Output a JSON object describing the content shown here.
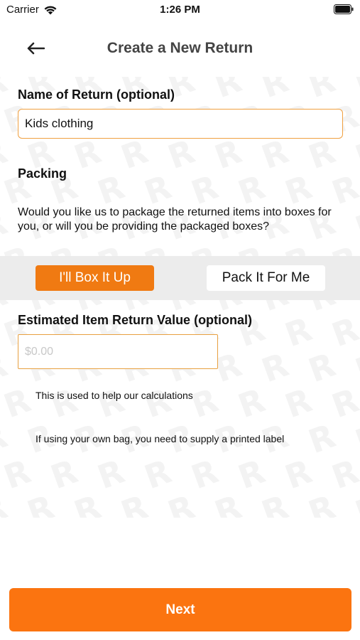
{
  "status_bar": {
    "carrier": "Carrier",
    "time": "1:26 PM"
  },
  "nav": {
    "title": "Create a New Return"
  },
  "return_name": {
    "label": "Name of Return (optional)",
    "value": "Kids clothing"
  },
  "packing": {
    "label": "Packing",
    "description": "Would you like us to package the returned items into boxes for you, or will you be providing the packaged boxes?",
    "options": [
      "I'll Box It Up",
      "Pack It For Me"
    ],
    "selected": "I'll Box It Up"
  },
  "estimated_value": {
    "label": "Estimated Item Return Value (optional)",
    "placeholder": "$0.00",
    "value": ""
  },
  "notes": {
    "calculations": "This is used to help our calculations",
    "bag_label": "If using your own bag, you need to supply a printed label"
  },
  "footer": {
    "next_label": "Next"
  },
  "colors": {
    "accent": "#fb7410",
    "selected_segment": "#f07a12",
    "input_border": "#f0a040",
    "band_background": "#ececec"
  }
}
